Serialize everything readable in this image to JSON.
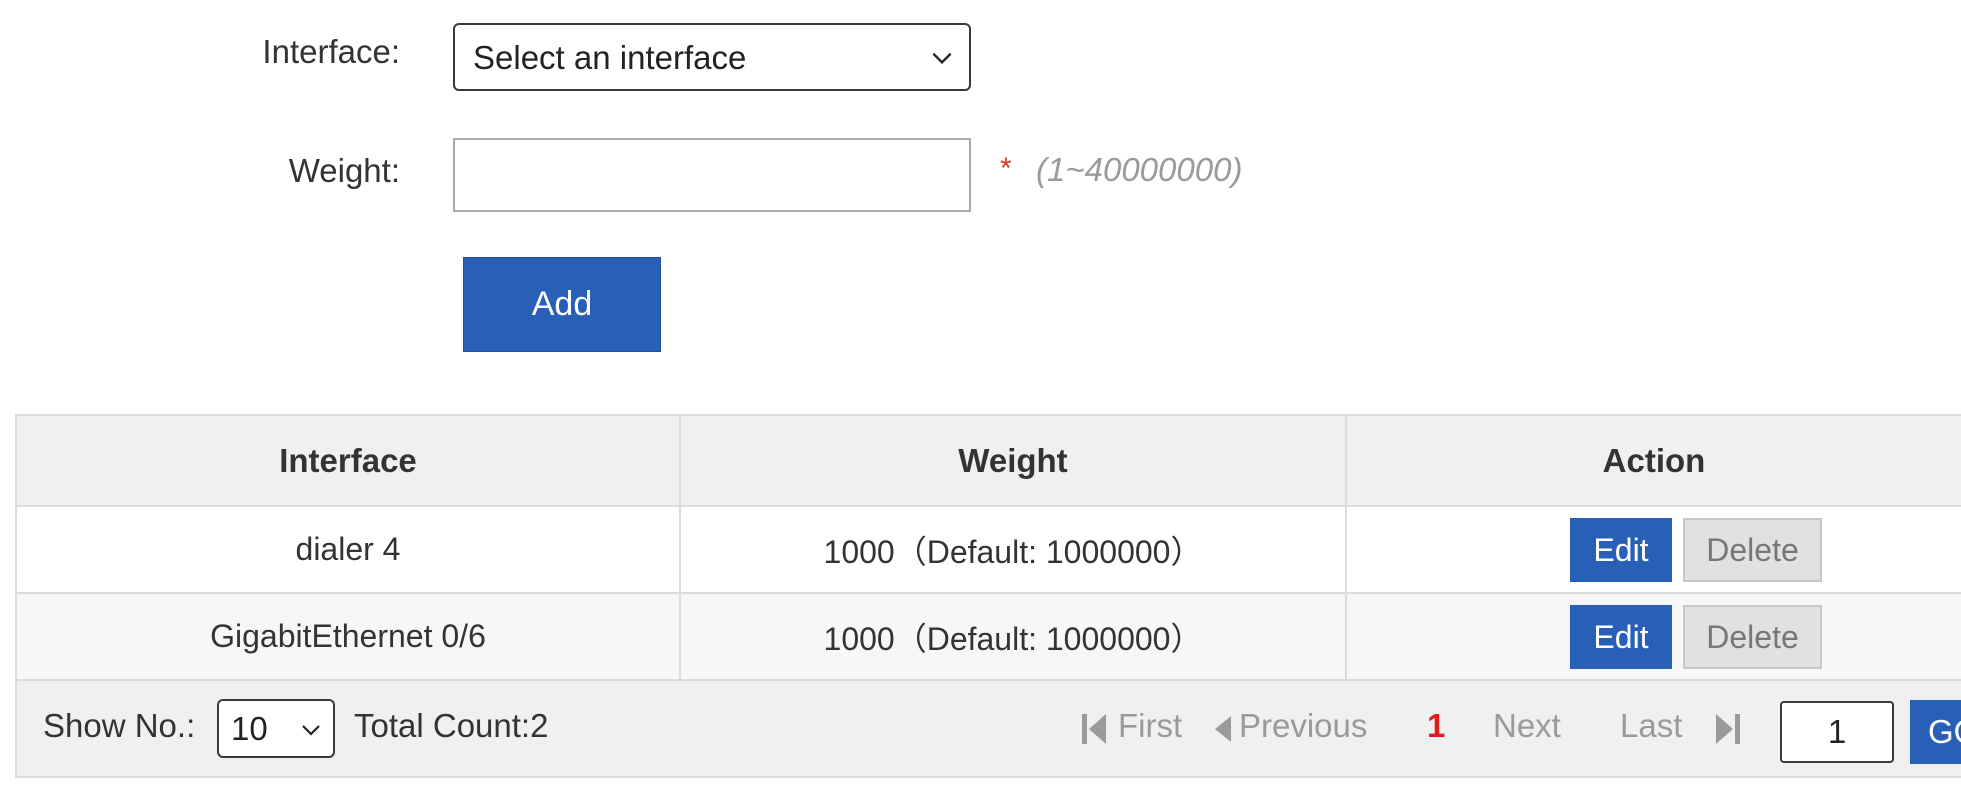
{
  "form": {
    "interface_label": "Interface:",
    "interface_value": "Select an interface",
    "weight_label": "Weight:",
    "weight_value": "",
    "required_mark": "*",
    "weight_hint": "(1~40000000)",
    "add_label": "Add"
  },
  "table": {
    "headers": [
      "Interface",
      "Weight",
      "Action"
    ],
    "rows": [
      {
        "interface": "dialer 4",
        "weight": "1000（Default: 1000000）",
        "edit": "Edit",
        "delete": "Delete"
      },
      {
        "interface": "GigabitEthernet 0/6",
        "weight": "1000（Default: 1000000）",
        "edit": "Edit",
        "delete": "Delete"
      }
    ]
  },
  "footer": {
    "show_label": "Show No.:",
    "show_value": "10",
    "total_count": "Total Count:2",
    "first": "First",
    "previous": "Previous",
    "current_page": "1",
    "next": "Next",
    "last": "Last",
    "goto_value": "1",
    "go_label": "GO"
  },
  "colors": {
    "primary": "#2860b8",
    "current_page": "#e01b1b",
    "required": "#e03a2a",
    "disabled_text": "#9a9a9a"
  },
  "icons": [
    "chevron-down-icon",
    "first-page-icon",
    "previous-page-icon",
    "last-page-icon"
  ]
}
